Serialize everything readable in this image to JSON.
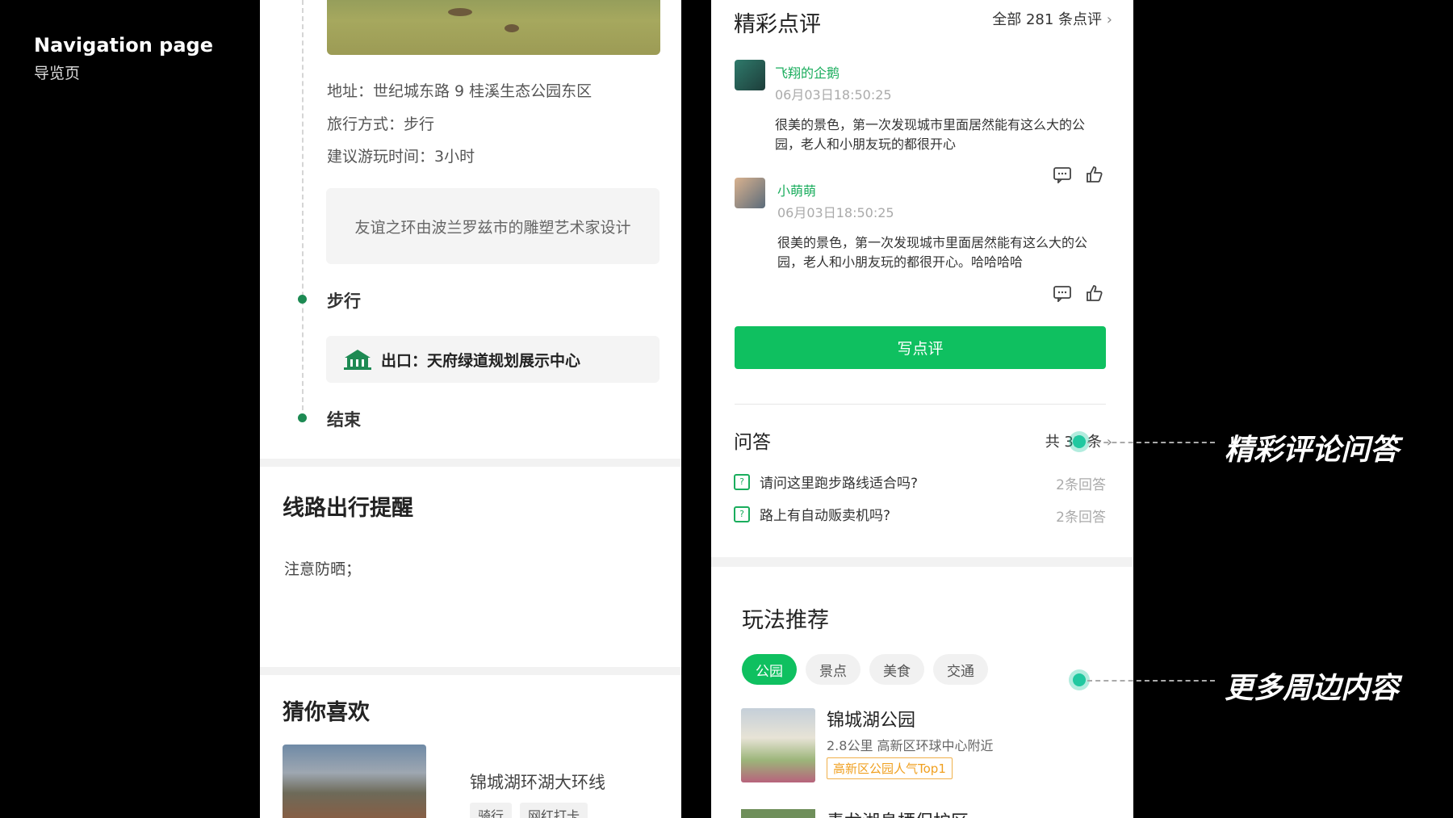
{
  "page": {
    "title_en": "Navigation page",
    "title_cn": "导览页"
  },
  "left": {
    "address": "地址：世纪城东路 9 桂溪生态公园东区",
    "travel_mode": "旅行方式：步行",
    "suggested_time": "建议游玩时间：3小时",
    "quote": "友谊之环由波兰罗兹市的雕塑艺术家设计",
    "step_walk": "步行",
    "exit_text": "出口：天府绿道规划展示中心",
    "step_end": "结束",
    "reminder_title": "线路出行提醒",
    "reminder_text": "注意防晒；",
    "guess_title": "猜你喜欢",
    "guess_item": {
      "name": "锦城湖环湖大环线",
      "tags": [
        "骑行",
        "网红打卡"
      ]
    }
  },
  "right": {
    "reviews_title": "精彩点评",
    "reviews_more": "全部 281 条点评",
    "reviews": [
      {
        "name": "飞翔的企鹅",
        "time": "06月03日18:50:25",
        "text": "很美的景色，第一次发现城市里面居然能有这么大的公园，老人和小朋友玩的都很开心"
      },
      {
        "name": "小萌萌",
        "time": "06月03日18:50:25",
        "text": "很美的景色，第一次发现城市里面居然能有这么大的公园，老人和小朋友玩的都很开心。哈哈哈哈"
      }
    ],
    "write_review": "写点评",
    "qa_title": "问答",
    "qa_count": "共 32 条",
    "qa_items": [
      {
        "q": "请问这里跑步路线适合吗?",
        "answers": "2条回答"
      },
      {
        "q": "路上有自动贩卖机吗?",
        "answers": "2条回答"
      }
    ],
    "play_title": "玩法推荐",
    "chips": [
      "公园",
      "景点",
      "美食",
      "交通"
    ],
    "park": {
      "name": "锦城湖公园",
      "distance": "2.8公里  高新区环球中心附近",
      "badge": "高新区公园人气Top1"
    },
    "next_item": "青龙湖息栖保护区"
  },
  "annotations": {
    "reviews_qa": "精彩评论问答",
    "more_nearby": "更多周边内容"
  },
  "colors": {
    "accent": "#0fc060",
    "name_green": "#1aad5d",
    "timeline_green": "#1d8a53",
    "badge_orange": "#f0a020"
  }
}
